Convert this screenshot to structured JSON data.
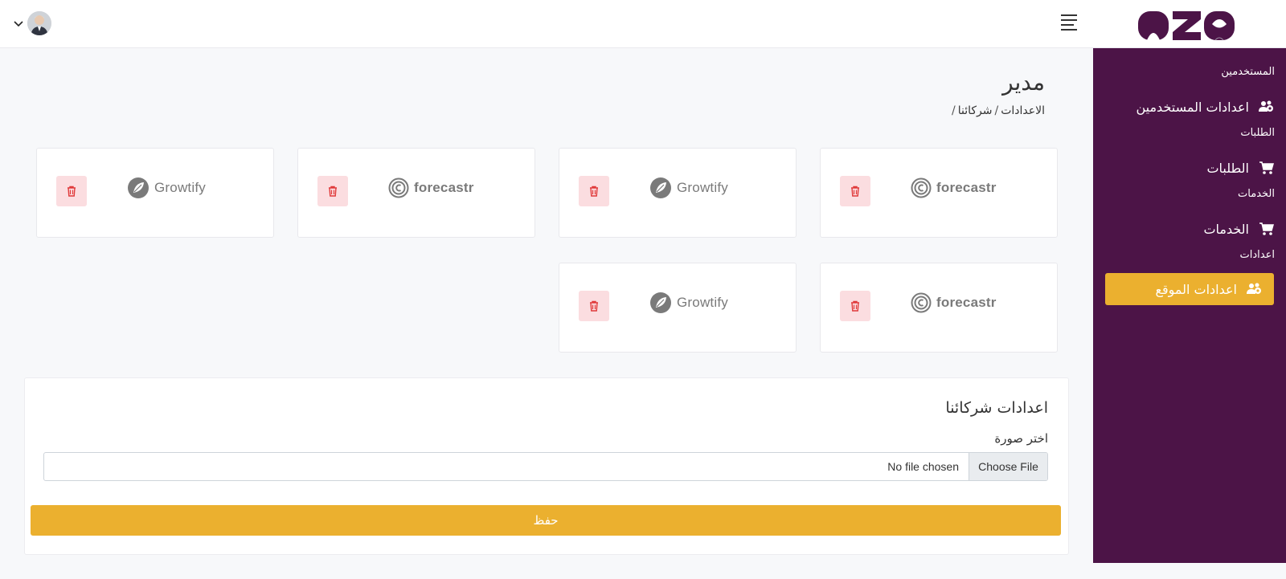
{
  "header": {
    "logo_text": "OZO",
    "brand_color": "#4c1447",
    "menu_icon": "hamburger-icon",
    "user_icon": "avatar",
    "dropdown_icon": "chevron-down-icon"
  },
  "sidebar": {
    "background": "#4c1447",
    "active_color": "#ebb02f",
    "groups": [
      {
        "category": "المستخدمين",
        "item": "اعدادات المستخدمين",
        "icon": "users-cog-icon"
      },
      {
        "category": "الطلبات",
        "item": "الطلبات",
        "icon": "cart-icon"
      },
      {
        "category": "الخدمات",
        "item": "الخدمات",
        "icon": "cart-icon"
      },
      {
        "category": "اعدادات",
        "item": "اعدادات الموقع",
        "icon": "users-cog-icon",
        "active": true
      }
    ]
  },
  "page": {
    "title": "مدير",
    "breadcrumb": [
      "الاعدادات",
      "شركائنا"
    ],
    "breadcrumb_separator": "/"
  },
  "partners": [
    {
      "logo": "forecastr",
      "icon": "forecastr-logo-icon"
    },
    {
      "logo": "Growtify",
      "icon": "growtify-logo-icon"
    },
    {
      "logo": "forecastr",
      "icon": "forecastr-logo-icon"
    },
    {
      "logo": "Growtify",
      "icon": "growtify-logo-icon"
    },
    {
      "logo": "forecastr",
      "icon": "forecastr-logo-icon"
    },
    {
      "logo": "Growtify",
      "icon": "growtify-logo-icon"
    }
  ],
  "form": {
    "title": "اعدادات شركائنا",
    "image_label": "اختر صورة",
    "file_button": "Choose File",
    "file_status": "No file chosen",
    "save_label": "حفظ",
    "accent_color": "#ebb02f",
    "delete_icon": "trash-icon"
  }
}
